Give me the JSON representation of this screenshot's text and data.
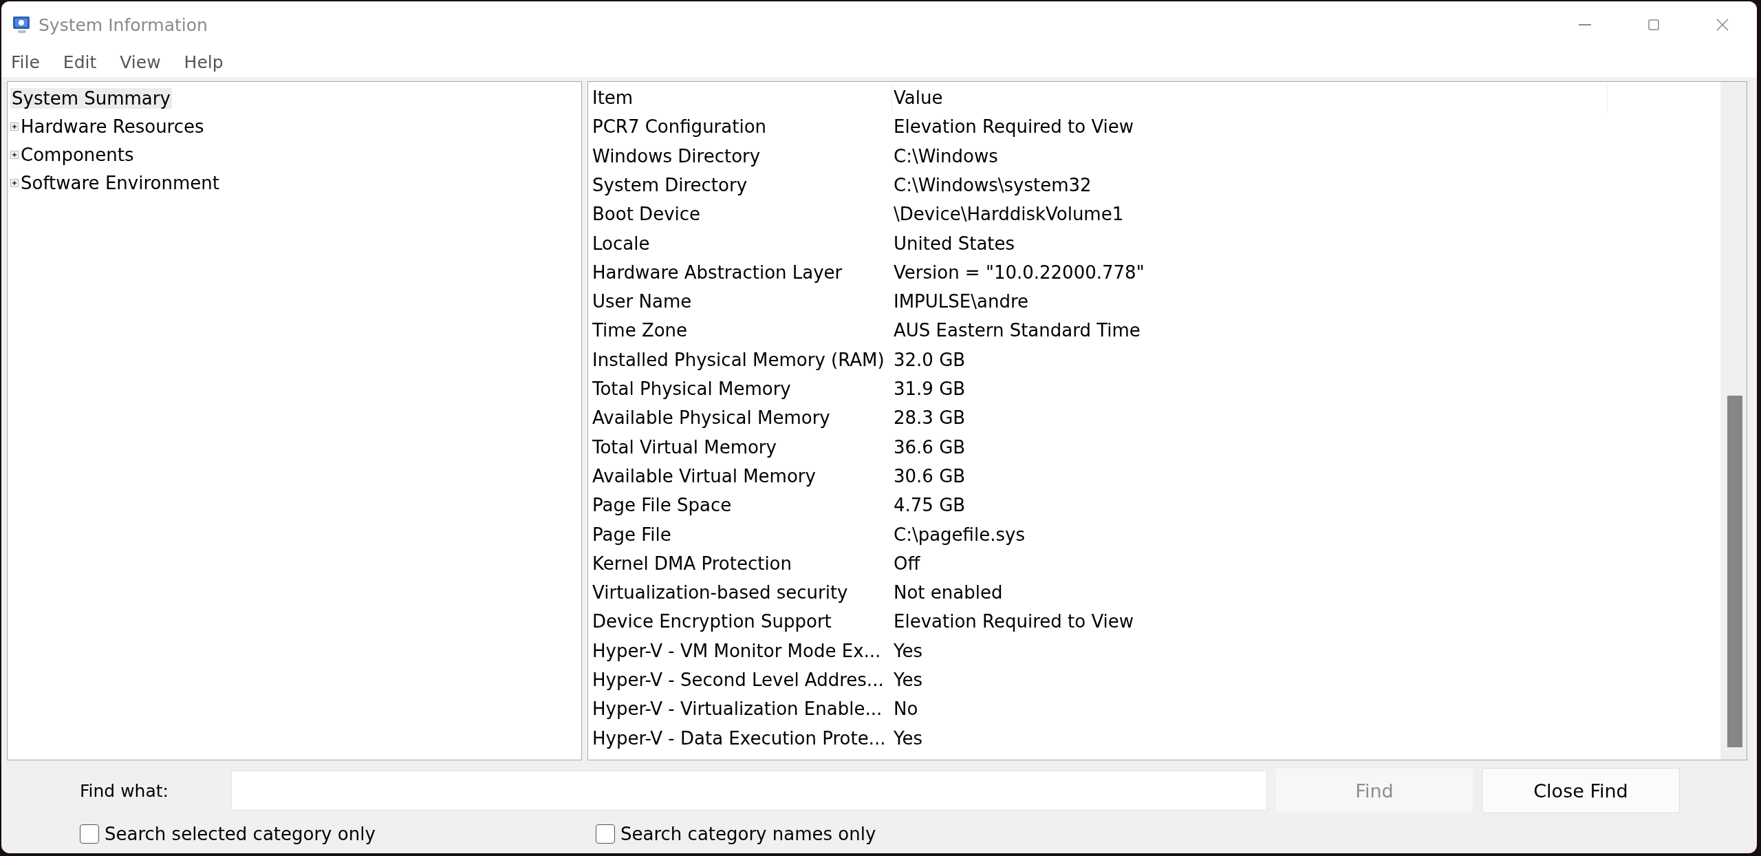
{
  "window": {
    "title": "System Information"
  },
  "menu": [
    "File",
    "Edit",
    "View",
    "Help"
  ],
  "tree": [
    {
      "label": "System Summary",
      "selected": true,
      "expandable": false
    },
    {
      "label": "Hardware Resources",
      "selected": false,
      "expandable": true
    },
    {
      "label": "Components",
      "selected": false,
      "expandable": true
    },
    {
      "label": "Software Environment",
      "selected": false,
      "expandable": true
    }
  ],
  "table": {
    "columns": [
      "Item",
      "Value"
    ],
    "rows": [
      [
        "PCR7 Configuration",
        "Elevation Required to View"
      ],
      [
        "Windows Directory",
        "C:\\Windows"
      ],
      [
        "System Directory",
        "C:\\Windows\\system32"
      ],
      [
        "Boot Device",
        "\\Device\\HarddiskVolume1"
      ],
      [
        "Locale",
        "United States"
      ],
      [
        "Hardware Abstraction Layer",
        "Version = \"10.0.22000.778\""
      ],
      [
        "User Name",
        "IMPULSE\\andre"
      ],
      [
        "Time Zone",
        "AUS Eastern Standard Time"
      ],
      [
        "Installed Physical Memory (RAM)",
        "32.0 GB"
      ],
      [
        "Total Physical Memory",
        "31.9 GB"
      ],
      [
        "Available Physical Memory",
        "28.3 GB"
      ],
      [
        "Total Virtual Memory",
        "36.6 GB"
      ],
      [
        "Available Virtual Memory",
        "30.6 GB"
      ],
      [
        "Page File Space",
        "4.75 GB"
      ],
      [
        "Page File",
        "C:\\pagefile.sys"
      ],
      [
        "Kernel DMA Protection",
        "Off"
      ],
      [
        "Virtualization-based security",
        "Not enabled"
      ],
      [
        "Device Encryption Support",
        "Elevation Required to View"
      ],
      [
        "Hyper-V - VM Monitor Mode Ex...",
        "Yes"
      ],
      [
        "Hyper-V - Second Level Addres...",
        "Yes"
      ],
      [
        "Hyper-V - Virtualization Enable...",
        "No"
      ],
      [
        "Hyper-V - Data Execution Prote...",
        "Yes"
      ]
    ]
  },
  "find": {
    "label": "Find what:",
    "find_button": {
      "label": "Find",
      "disabled": true
    },
    "close_button": {
      "label": "Close Find",
      "disabled": false
    },
    "options": [
      {
        "label": "Search selected category only",
        "checked": false
      },
      {
        "label": "Search category names only",
        "checked": false
      }
    ]
  }
}
